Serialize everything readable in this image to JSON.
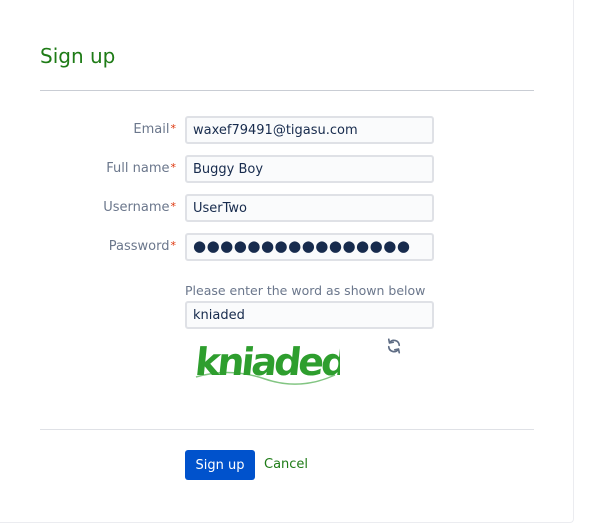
{
  "dialog": {
    "title": "Sign up"
  },
  "form": {
    "email": {
      "label": "Email",
      "required_marker": "*",
      "value": "waxef79491@tigasu.com"
    },
    "full_name": {
      "label": "Full name",
      "required_marker": "*",
      "value": "Buggy Boy"
    },
    "username": {
      "label": "Username",
      "required_marker": "*",
      "value": "UserTwo"
    },
    "password": {
      "label": "Password",
      "required_marker": "*",
      "value": "●●●●●●●●●●●●●●●●"
    },
    "captcha": {
      "hint": "Please enter the word as shown below",
      "value": "kniaded",
      "image_word": "kniaded",
      "image_color": "#2e9e2e",
      "refresh_icon": "refresh-icon"
    }
  },
  "actions": {
    "submit_label": "Sign up",
    "cancel_label": "Cancel"
  },
  "colors": {
    "title": "#1e7b16",
    "primary_button": "#0052cc",
    "required": "#de350b",
    "link": "#1e7b16"
  }
}
